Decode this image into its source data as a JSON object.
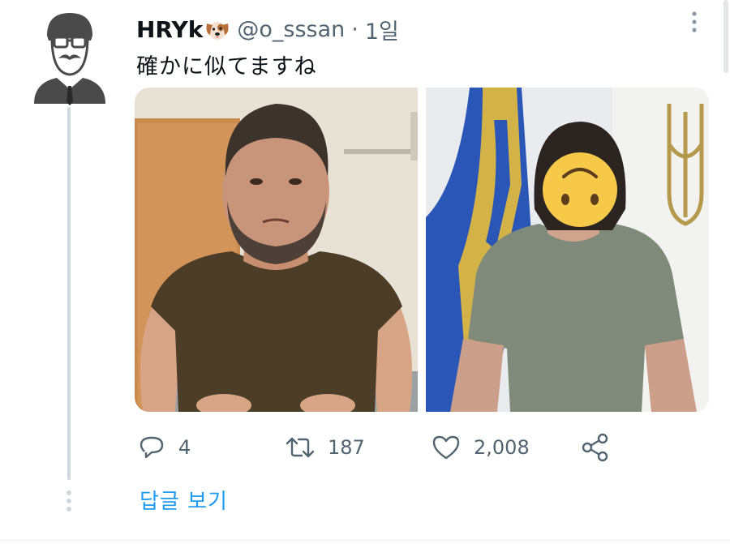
{
  "tweet": {
    "display_name": "HRYk",
    "name_emoji": "dog-face",
    "handle": "@o_sssan",
    "separator": "·",
    "time_ago": "1일",
    "text": "確かに似てますね",
    "media": [
      {
        "description": "man in tight olive t-shirt against wooden door"
      },
      {
        "description": "person in grey t-shirt with face covered by upside-down smiley emoji, flag in background"
      }
    ]
  },
  "actions": {
    "reply": {
      "icon": "reply-icon",
      "count": "4"
    },
    "retweet": {
      "icon": "retweet-icon",
      "count": "187"
    },
    "like": {
      "icon": "heart-icon",
      "count": "2,008"
    },
    "share": {
      "icon": "share-icon"
    }
  },
  "thread": {
    "show_replies_label": "답글 보기"
  },
  "colors": {
    "accent": "#1d9bf0",
    "secondary_text": "#536471",
    "thread_line": "#cfd9de"
  }
}
